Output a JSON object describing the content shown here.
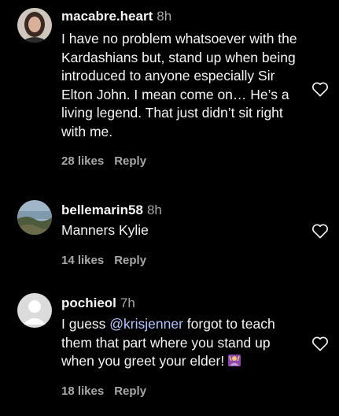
{
  "comments": [
    {
      "username": "macabre.heart",
      "time": "8h",
      "text": "I have no problem whatsoever with the Kardashians but, stand up when being introduced to anyone especially Sir Elton John. I mean come on… He’s a living legend. That just didn’t sit right with me.",
      "likes": "28 likes",
      "reply": "Reply",
      "avatar": "woman-portrait-avatar"
    },
    {
      "username": "bellemarin58",
      "time": "8h",
      "text": "Manners Kylie",
      "likes": "14 likes",
      "reply": "Reply",
      "avatar": "coastal-landscape-avatar"
    },
    {
      "username": "pochieol",
      "time": "7h",
      "text_prefix": "I guess ",
      "mention": "@krisjenner",
      "text_suffix": " forgot to teach them that part where you stand up when you greet your elder!",
      "emoji": "woman-raising-hands-emoji",
      "likes": "18 likes",
      "reply": "Reply",
      "avatar": "default-user-avatar"
    }
  ],
  "icons": {
    "like": "heart-outline-icon"
  },
  "colors": {
    "background": "#000000",
    "text": "#f5f5f5",
    "secondary": "#a8a8a8",
    "mention": "#b3c6ff",
    "emoji": "#8e44ad"
  }
}
